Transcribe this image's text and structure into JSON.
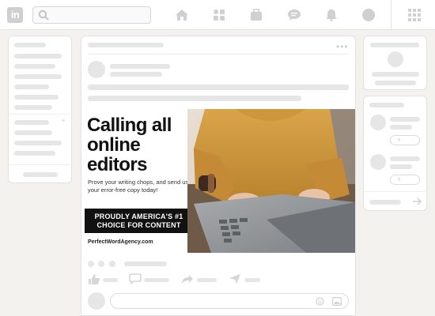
{
  "header": {
    "logo_text": "in",
    "nav_icons": [
      "home-icon",
      "network-icon",
      "jobs-icon",
      "messaging-icon",
      "notifications-icon",
      "me-icon"
    ],
    "grid_icon": "apps-grid-icon"
  },
  "ad": {
    "headline": "Calling all online editors",
    "subtext": "Prove your writing chops, and send us your error-free copy today!",
    "badge_line1": "PROUDLY AMERICA'S #1",
    "badge_line2": "CHOICE FOR CONTENT",
    "url": "PerfectWordAgency.com"
  },
  "colors": {
    "background": "#f3f2ef",
    "placeholder": "#e6e6e6",
    "ad_text": "#111111",
    "photo_sweater": "#d49a3c"
  }
}
